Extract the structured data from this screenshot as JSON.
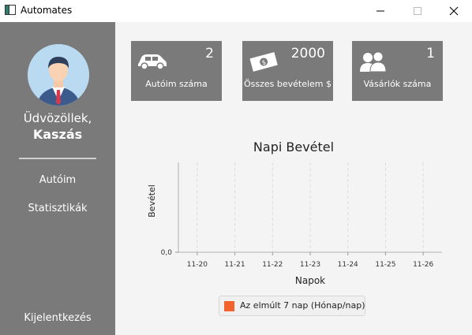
{
  "window": {
    "title": "Automates",
    "controls": {
      "minimize": "minimize-icon",
      "maximize": "maximize-icon",
      "close": "close-icon"
    }
  },
  "sidebar": {
    "greeting": "Üdvözöllek,",
    "username": "Kaszás",
    "nav_items": [
      "Autóim",
      "Statisztikák"
    ],
    "logout_label": "Kijelentkezés"
  },
  "stats": [
    {
      "icon": "car-icon",
      "value": "2",
      "label": "Autóim száma"
    },
    {
      "icon": "money-icon",
      "value": "2000",
      "label": "Összes bevételem $"
    },
    {
      "icon": "users-icon",
      "value": "1",
      "label": "Vásárlók száma"
    }
  ],
  "colors": {
    "sidebar": "#7a7a7a",
    "card": "#7a7a7a",
    "series": "#f3622d"
  },
  "chart_data": {
    "type": "line",
    "title": "Napi Bevétel",
    "xlabel": "Napok",
    "ylabel": "Bevétel",
    "categories": [
      "11-20",
      "11-21",
      "11-22",
      "11-23",
      "11-24",
      "11-25",
      "11-26"
    ],
    "y_tick_labels": [
      "0,0"
    ],
    "grid": true,
    "legend_position": "bottom",
    "series": [
      {
        "name": "Az elmúlt 7 nap (Hónap/nap)",
        "values": []
      }
    ]
  }
}
